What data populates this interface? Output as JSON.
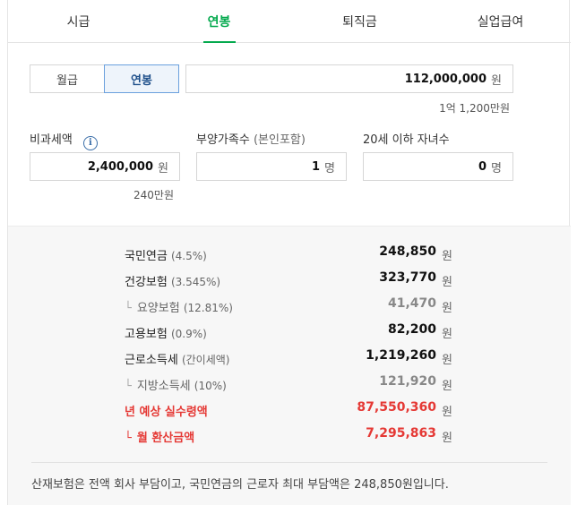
{
  "tabs": [
    "시급",
    "연봉",
    "퇴직금",
    "실업급여"
  ],
  "active_tab": "연봉",
  "pay_type": {
    "options": [
      "월급",
      "연봉"
    ],
    "selected": "연봉"
  },
  "salary": {
    "value": "112,000,000",
    "unit": "원",
    "hint": "1억 1,200만원"
  },
  "nontax": {
    "label": "비과세액",
    "info": "i",
    "value": "2,400,000",
    "unit": "원",
    "hint": "240만원"
  },
  "dependents": {
    "label": "부양가족수",
    "sub": "(본인포함)",
    "value": "1",
    "unit": "명"
  },
  "children": {
    "label": "20세 이하 자녀수",
    "value": "0",
    "unit": "명"
  },
  "results": [
    {
      "name": "국민연금",
      "pct": "(4.5%)",
      "amount": "248,850",
      "unit": "원",
      "type": "main"
    },
    {
      "name": "건강보험",
      "pct": "(3.545%)",
      "amount": "323,770",
      "unit": "원",
      "type": "main"
    },
    {
      "corner": "└",
      "name": "요양보험",
      "pct": "(12.81%)",
      "amount": "41,470",
      "unit": "원",
      "type": "sub"
    },
    {
      "name": "고용보험",
      "pct": "(0.9%)",
      "amount": "82,200",
      "unit": "원",
      "type": "main"
    },
    {
      "name": "근로소득세",
      "pct": "(간이세액)",
      "amount": "1,219,260",
      "unit": "원",
      "type": "main"
    },
    {
      "corner": "└",
      "name": "지방소득세",
      "pct": "(10%)",
      "amount": "121,920",
      "unit": "원",
      "type": "sub"
    },
    {
      "name": "년 예상 실수령액",
      "pct": "",
      "amount": "87,550,360",
      "unit": "원",
      "type": "red"
    },
    {
      "corner": "└",
      "name": "월 환산금액",
      "pct": "",
      "amount": "7,295,863",
      "unit": "원",
      "type": "red"
    }
  ],
  "note": "산재보험은 전액 회사 부담이고, 국민연금의 근로자 최대 부담액은 248,850원입니다.",
  "colors": {
    "accent": "#03a94d",
    "red": "#e53935",
    "selected_border": "#6aa0dd"
  }
}
